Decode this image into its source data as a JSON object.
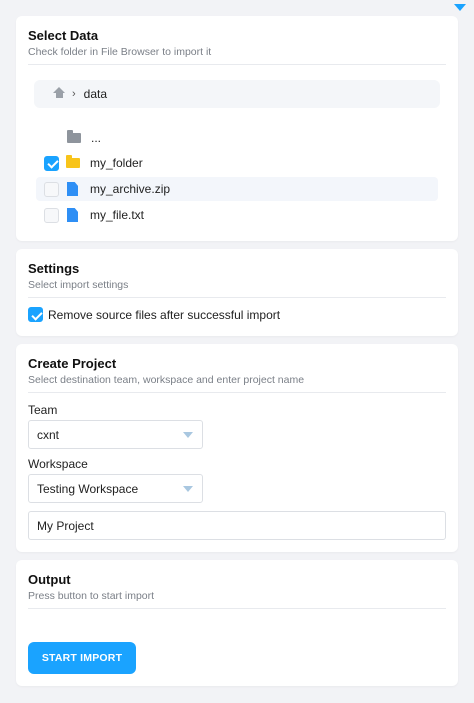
{
  "select_data": {
    "title": "Select Data",
    "description": "Check folder in File Browser to import it",
    "breadcrumb": {
      "icon": "home-icon",
      "path": "data"
    },
    "items": [
      {
        "name": "...",
        "type": "folder",
        "icon": "folder-icon",
        "checked": false,
        "has_checkbox": false
      },
      {
        "name": "my_folder",
        "type": "folder",
        "icon": "folder-icon",
        "checked": true,
        "has_checkbox": true
      },
      {
        "name": "my_archive.zip",
        "type": "file",
        "icon": "file-icon",
        "checked": false,
        "has_checkbox": true
      },
      {
        "name": "my_file.txt",
        "type": "file",
        "icon": "file-icon",
        "checked": false,
        "has_checkbox": true
      }
    ]
  },
  "settings": {
    "title": "Settings",
    "description": "Select import settings",
    "remove_source_label": "Remove source files after successful import",
    "remove_source_checked": true
  },
  "create_project": {
    "title": "Create Project",
    "description": "Select destination team, workspace and enter project name",
    "team_label": "Team",
    "team_value": "cxnt",
    "workspace_label": "Workspace",
    "workspace_value": "Testing Workspace",
    "project_name_value": "My Project"
  },
  "output": {
    "title": "Output",
    "description": "Press button to start import",
    "button_label": "START IMPORT"
  },
  "colors": {
    "accent": "#1aa3ff",
    "folder_gray": "#8e949c",
    "folder_yellow": "#f8c41a",
    "file_blue": "#2f8ff5"
  }
}
